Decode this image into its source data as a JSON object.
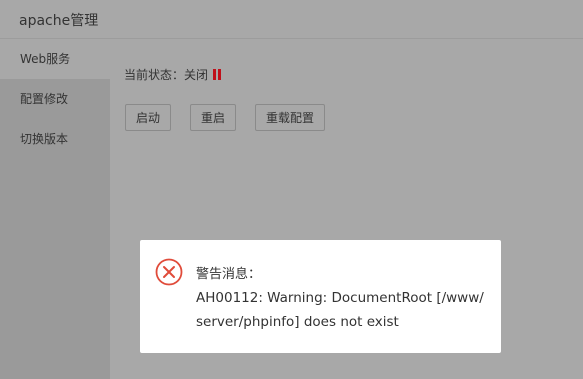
{
  "app": {
    "title": "apache管理"
  },
  "sidebar": {
    "items": [
      {
        "label": "Web服务",
        "active": true
      },
      {
        "label": "配置修改",
        "active": false
      },
      {
        "label": "切换版本",
        "active": false
      }
    ]
  },
  "main": {
    "status_label": "当前状态：",
    "status_value": "关闭",
    "status_icon": "pause-icon",
    "status_color": "#c0101a",
    "buttons": {
      "start": "启动",
      "restart": "重启",
      "reload": "重载配置"
    }
  },
  "dialog": {
    "icon": "error-x-icon",
    "icon_color": "#e04b3a",
    "title": "警告消息：",
    "message": "AH00112: Warning: DocumentRoot [/www/server/phpinfo] does not exist"
  }
}
